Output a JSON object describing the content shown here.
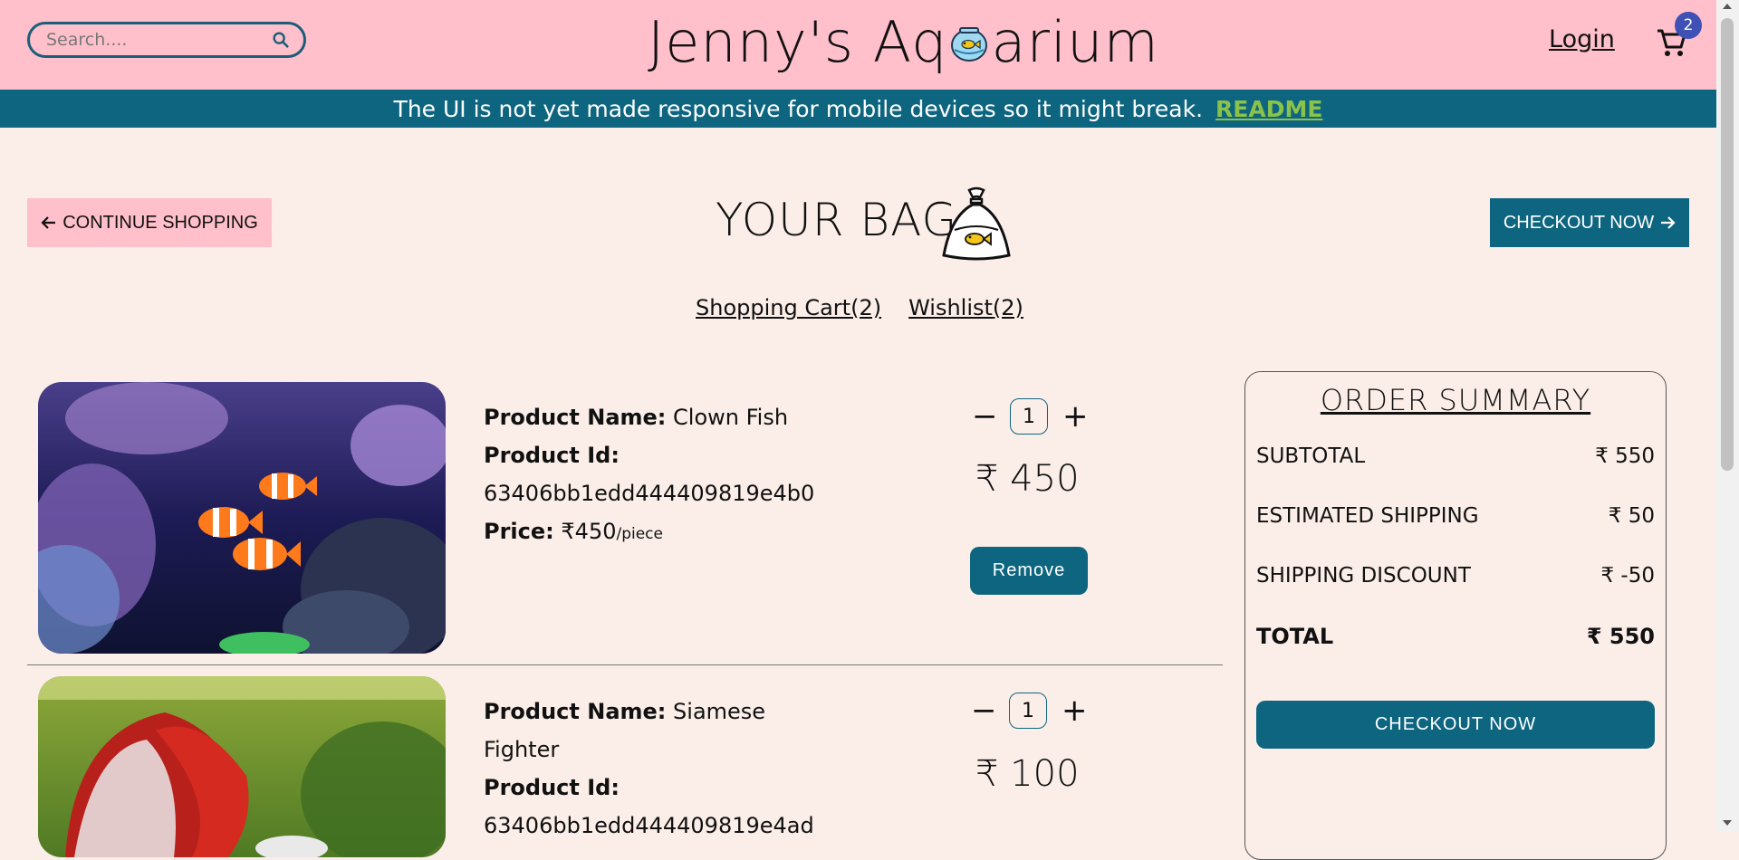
{
  "header": {
    "search_placeholder": "Search....",
    "logo_left": "Jenny's Aq",
    "logo_right": "arium",
    "login_label": "Login",
    "cart_count": "2"
  },
  "banner": {
    "message": "The UI is not yet made responsive for mobile devices so it might break.",
    "link_label": "README",
    "link_color": "#8bc34a"
  },
  "bag": {
    "continue_label": "CONTINUE SHOPPING",
    "title": "YOUR BAG",
    "checkout_top_label": "CHECKOUT NOW",
    "tabs": [
      {
        "label": "Shopping Cart(2)"
      },
      {
        "label": "Wishlist(2)"
      }
    ]
  },
  "items": [
    {
      "name_label": "Product Name:",
      "name": "Clown Fish",
      "id_label": "Product Id:",
      "id": "63406bb1edd444409819e4b0",
      "price_label": "Price:",
      "unit_price": "₹450",
      "per": "/piece",
      "qty": "1",
      "total": "₹ 450",
      "remove_label": "Remove"
    },
    {
      "name_label": "Product Name:",
      "name": "Siamese Fighter",
      "id_label": "Product Id:",
      "id": "63406bb1edd444409819e4ad",
      "qty": "1",
      "total": "₹ 100"
    }
  ],
  "summary": {
    "title": "ORDER SUMMARY",
    "rows": [
      {
        "label": "SUBTOTAL",
        "value": "₹ 550"
      },
      {
        "label": "ESTIMATED SHIPPING",
        "value": "₹ 50"
      },
      {
        "label": "SHIPPING DISCOUNT",
        "value": "₹ -50"
      },
      {
        "label": "TOTAL",
        "value": "₹ 550"
      }
    ],
    "checkout_label": "CHECKOUT NOW"
  },
  "colors": {
    "navbar": "#ffc0cb",
    "accent": "#0d6580",
    "page_bg": "#fbeee8",
    "badge": "#3f51b5"
  },
  "icons": [
    "search-icon",
    "fishbowl-icon",
    "cart-icon",
    "arrow-left-icon",
    "fish-bag-icon",
    "arrow-right-icon",
    "minus-icon",
    "plus-icon"
  ]
}
